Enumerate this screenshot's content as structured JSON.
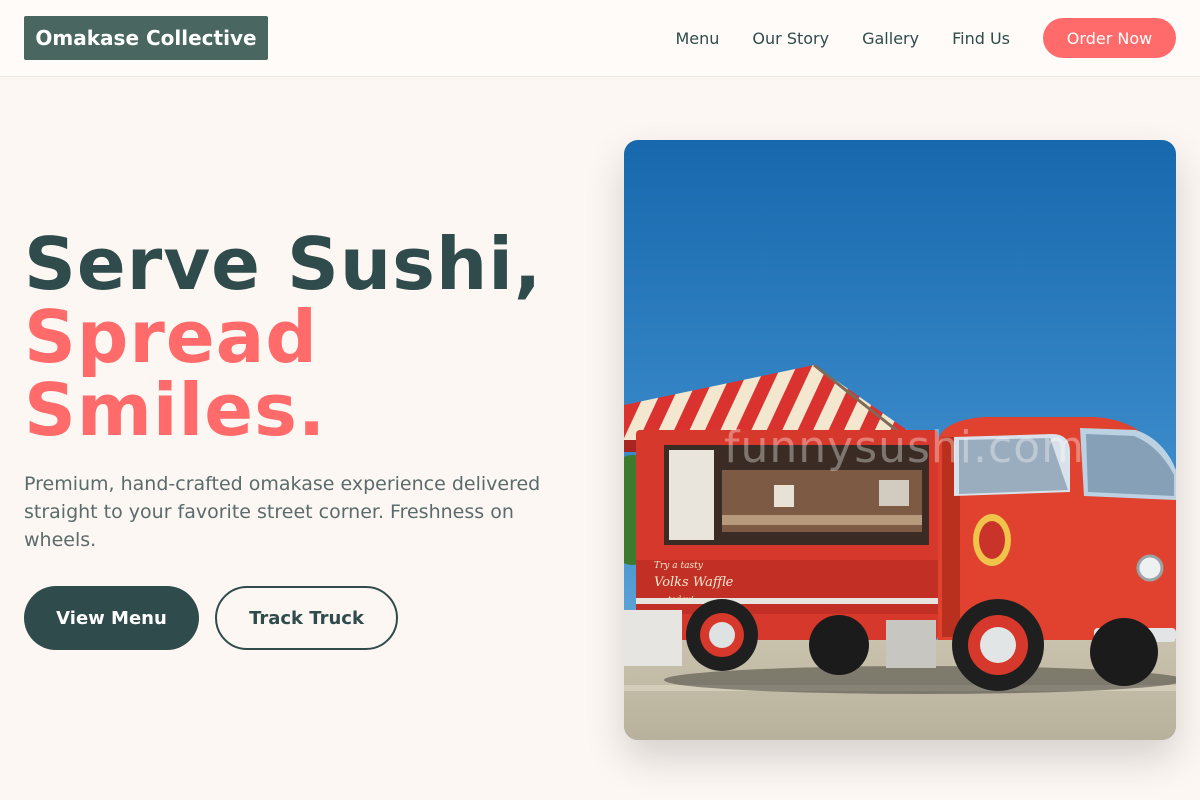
{
  "brand": {
    "name": "Omakase Collective"
  },
  "nav": {
    "items": [
      "Menu",
      "Our Story",
      "Gallery",
      "Find Us"
    ],
    "cta": "Order Now"
  },
  "hero": {
    "headline_line1": "Serve Sushi,",
    "headline_line2": "Spread",
    "headline_line3": "Smiles.",
    "subtitle": "Premium, hand-crafted omakase experience delivered straight to your favorite street corner. Freshness on wheels.",
    "primary_cta": "View Menu",
    "secondary_cta": "Track Truck",
    "image_watermark": "funnysushi.com",
    "truck_signage_1": "Try a tasty",
    "truck_signage_2": "Volks Waffle",
    "truck_signage_3": "today!"
  },
  "colors": {
    "background": "#fdf7f3",
    "primary": "#2f4b4b",
    "accent": "#ff6b6b",
    "logo_bg": "#4a6660"
  }
}
